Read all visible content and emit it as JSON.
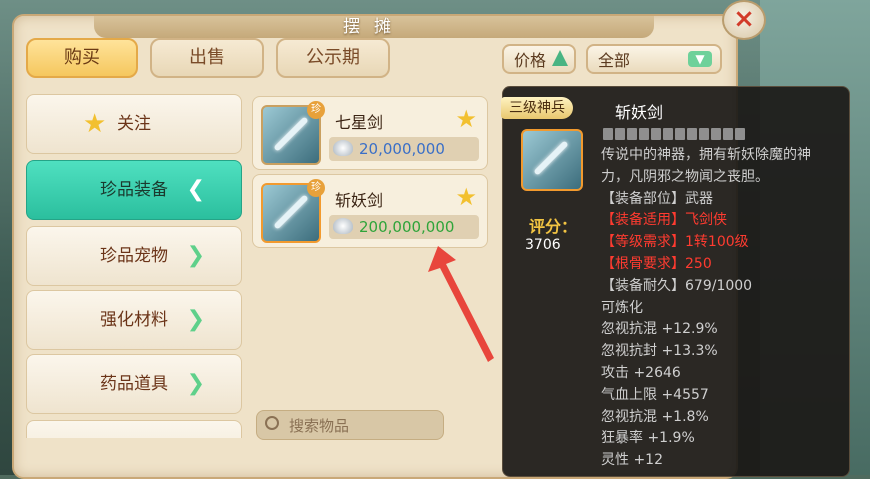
{
  "window": {
    "title": "摆摊",
    "close_label": "×"
  },
  "tabs": [
    {
      "label": "购买",
      "active": true
    },
    {
      "label": "出售",
      "active": false
    },
    {
      "label": "公示期",
      "active": false
    }
  ],
  "sort": {
    "label": "价格",
    "direction": "up"
  },
  "filter": {
    "selected": "全部"
  },
  "sidebar": [
    {
      "label": "关注",
      "icon": "star-icon"
    },
    {
      "label": "珍品装备",
      "active": true
    },
    {
      "label": "珍品宠物"
    },
    {
      "label": "强化材料"
    },
    {
      "label": "药品道具"
    }
  ],
  "items": [
    {
      "name": "七星剑",
      "price": "20,000,000",
      "badge": "珍",
      "price_color": "#3a6fc7"
    },
    {
      "name": "斩妖剑",
      "price": "200,000,000",
      "badge": "珍",
      "price_color": "#2fa43a"
    }
  ],
  "search": {
    "placeholder": "搜索物品"
  },
  "tooltip": {
    "rank": "三级神兵",
    "name": "斩妖剑",
    "score_label": "评分：",
    "score": "3706",
    "desc_lines": [
      "传说中的神器，拥有斩妖除魔的神",
      "力，凡阴邪之物闻之丧胆。"
    ],
    "stats": [
      {
        "text": "【装备部位】武器",
        "color": "#cfcfcf"
      },
      {
        "text": "【装备适用】飞剑侠",
        "color": "#ff3b30"
      },
      {
        "text": "【等级需求】1转100级",
        "color": "#ff3b30"
      },
      {
        "text": "【根骨要求】250",
        "color": "#ff3b30"
      },
      {
        "text": "【装备耐久】679/1000",
        "color": "#cfcfcf"
      },
      {
        "text": "可炼化",
        "color": "#cfcfcf"
      },
      {
        "text": "忽视抗混 +12.9%",
        "color": "#cfcfcf"
      },
      {
        "text": "忽视抗封 +13.3%",
        "color": "#cfcfcf"
      },
      {
        "text": "攻击 +2646",
        "color": "#cfcfcf"
      },
      {
        "text": "气血上限 +4557",
        "color": "#cfcfcf"
      },
      {
        "text": "忽视抗混 +1.8%",
        "color": "#cfcfcf"
      },
      {
        "text": "狂暴率 +1.9%",
        "color": "#cfcfcf"
      },
      {
        "text": "灵性 +12",
        "color": "#cfcfcf"
      }
    ]
  },
  "colors": {
    "accent": "#2bbf9e",
    "tab_active": "#f5c75e",
    "arrow": "#e8463c"
  }
}
